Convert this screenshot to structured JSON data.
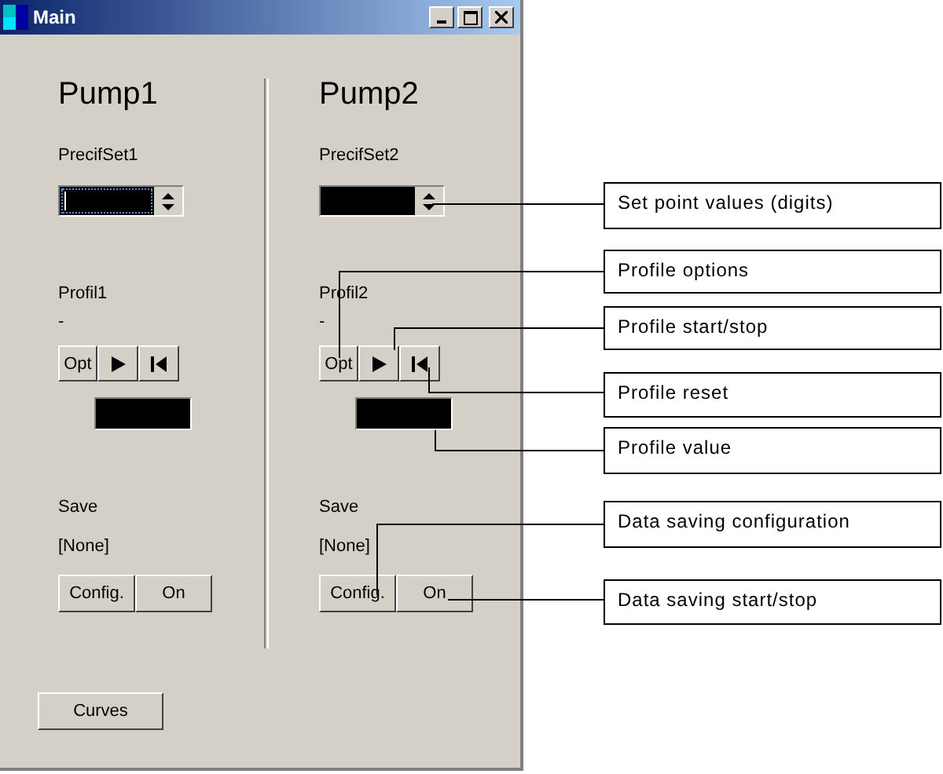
{
  "window": {
    "title": "Main"
  },
  "pumps": [
    {
      "title": "Pump1",
      "setpoint_label": "PrecifSet1",
      "setpoint_focused": true,
      "profile_label": "Profil1",
      "profile_status": "-",
      "options_button": "Opt",
      "save_label": "Save",
      "save_target": "[None]",
      "config_button": "Config.",
      "saving_button": "On"
    },
    {
      "title": "Pump2",
      "setpoint_label": "PrecifSet2",
      "setpoint_focused": false,
      "profile_label": "Profil2",
      "profile_status": "-",
      "options_button": "Opt",
      "save_label": "Save",
      "save_target": "[None]",
      "config_button": "Config.",
      "saving_button": "On"
    }
  ],
  "curves_button": "Curves",
  "callouts": [
    "Set point values (digits)",
    "Profile options",
    "Profile start/stop",
    "Profile reset",
    "Profile value",
    "Data saving configuration",
    "Data saving start/stop"
  ]
}
